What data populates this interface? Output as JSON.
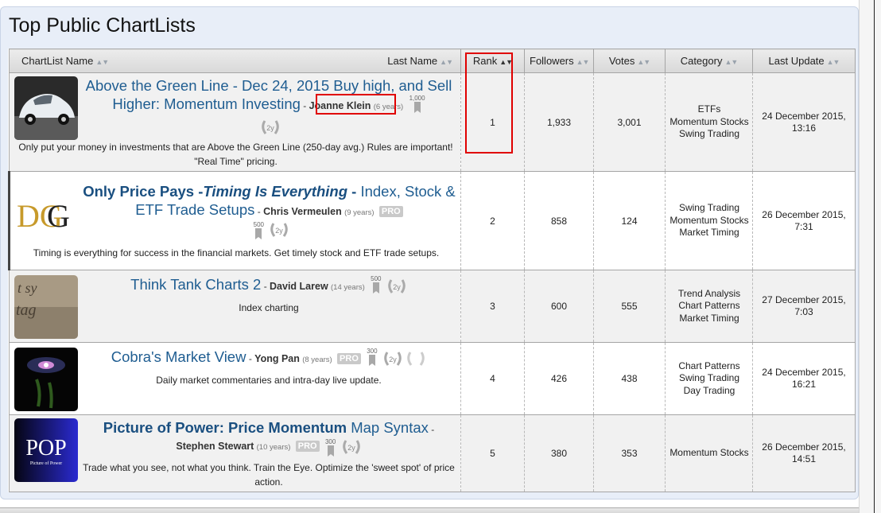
{
  "page": {
    "title": "Top Public ChartLists"
  },
  "columns": {
    "name": "ChartList Name",
    "last_name": "Last Name",
    "rank": "Rank",
    "followers": "Followers",
    "votes": "Votes",
    "category": "Category",
    "last_update": "Last Update"
  },
  "rows": [
    {
      "title": "Above the Green Line - Dec 24, 2015 Buy high, and Sell Higher: Momentum Investing",
      "author": "Joanne Klein",
      "years": "(6 years)",
      "pro": "",
      "vote_count": "1,000",
      "description": "Only put your money in investments that are Above the Green Line (250-day avg.) Rules are important! \"Real Time\" pricing.",
      "rank": "1",
      "followers": "1,933",
      "votes": "3,001",
      "categories": [
        "ETFs",
        "Momentum Stocks",
        "Swing Trading"
      ],
      "date": "24 December 2015,",
      "time": "13:16",
      "thumb": "car-icon"
    },
    {
      "title_bold1": "Only Price Pays -",
      "title_italic": "Timing Is Everything",
      "title_bold2": " - ",
      "title_rest": "Index, Stock & ETF Trade Setups",
      "author": "Chris Vermeulen",
      "years": "(9 years)",
      "pro": "PRO",
      "vote_count": "500",
      "description": "Timing is everything for success in the financial markets. Get timely stock and ETF trade setups.",
      "rank": "2",
      "followers": "858",
      "votes": "124",
      "categories": [
        "Swing Trading",
        "Momentum Stocks",
        "Market Timing"
      ],
      "date": "26 December 2015,",
      "time": "7:31",
      "thumb": "tdg-logo",
      "logo_text": "DG"
    },
    {
      "title": "Think Tank Charts 2",
      "author": "David Larew",
      "years": "(14 years)",
      "pro": "",
      "vote_count": "500",
      "description": "Index charting",
      "rank": "3",
      "followers": "600",
      "votes": "555",
      "categories": [
        "Trend Analysis",
        "Chart Patterns",
        "Market Timing"
      ],
      "date": "27 December 2015,",
      "time": "7:03",
      "thumb": "stone-text-image"
    },
    {
      "title": "Cobra's Market View",
      "author": "Yong Pan",
      "years": "(8 years)",
      "pro": "PRO",
      "vote_count": "300",
      "description": "Daily market commentaries and intra-day live update.",
      "rank": "4",
      "followers": "426",
      "votes": "438",
      "categories": [
        "Chart Patterns",
        "Swing Trading",
        "Day Trading"
      ],
      "date": "24 December 2015,",
      "time": "16:21",
      "thumb": "galaxy-image"
    },
    {
      "title_bold": "Picture of Power: Price Momentum",
      "title_rest": " Map Syntax",
      "author": "Stephen Stewart",
      "years": "(10 years)",
      "pro": "PRO",
      "vote_count": "300",
      "description": "Trade what you see, not what you think. Train the Eye. Optimize the 'sweet spot' of price action.",
      "rank": "5",
      "followers": "380",
      "votes": "353",
      "categories": [
        "Momentum Stocks"
      ],
      "date": "26 December 2015,",
      "time": "14:51",
      "thumb": "pop-logo",
      "logo_text": "POP",
      "logo_sub": "Picture of Power"
    }
  ],
  "medal_label": "2y",
  "colors": {
    "link": "#1f5d91",
    "highlight": "#e00000",
    "panel": "#e8eef8"
  }
}
